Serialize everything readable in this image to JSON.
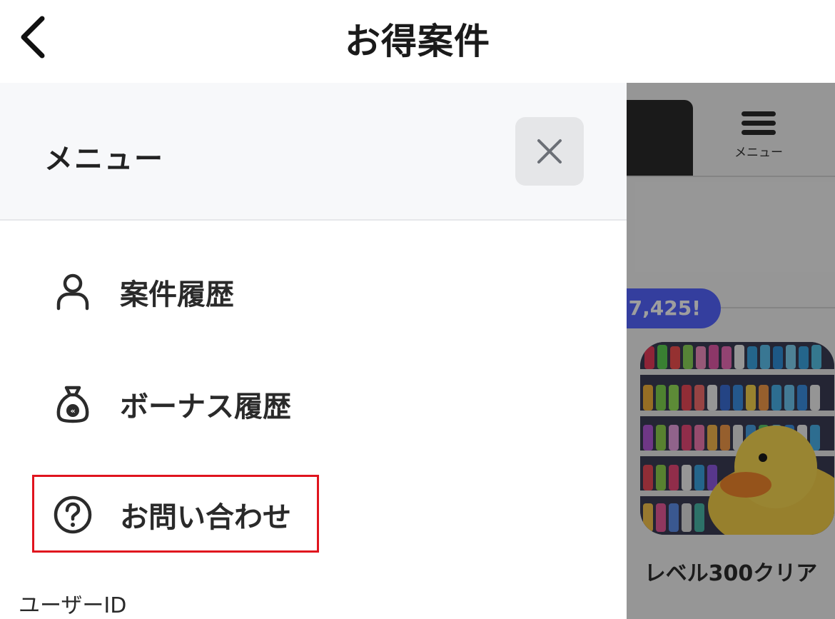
{
  "header": {
    "title": "お得案件",
    "back_icon": "chevron-left-icon"
  },
  "drawer": {
    "title": "メニュー",
    "close_icon": "close-icon",
    "items": [
      {
        "label": "案件履歴",
        "icon": "user-icon"
      },
      {
        "label": "ボーナス履歴",
        "icon": "money-bag-icon"
      },
      {
        "label": "お問い合わせ",
        "icon": "help-circle-icon",
        "highlighted": true
      }
    ],
    "user_id_label": "ユーザーID"
  },
  "background": {
    "menu_label": "メニュー",
    "badge_text": "+7,425!",
    "card_title": "レベル300クリア"
  },
  "colors": {
    "highlight_border": "#e0141e",
    "badge": "#5465ff",
    "drawer_header_bg": "#f7f8fa"
  }
}
